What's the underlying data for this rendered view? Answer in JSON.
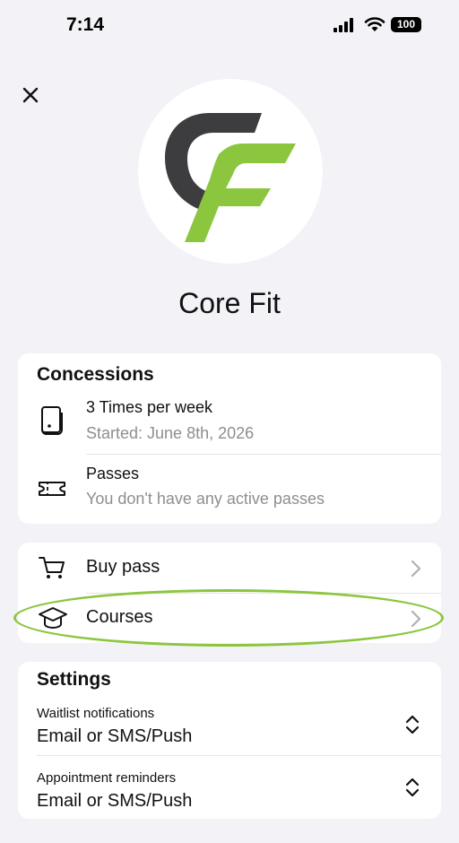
{
  "status_bar": {
    "time": "7:14",
    "battery": "100"
  },
  "profile": {
    "name": "Core Fit"
  },
  "concessions": {
    "title": "Concessions",
    "items": [
      {
        "title": "3 Times per week",
        "subtitle": "Started: June 8th, 2026",
        "icon": "membership-card-icon"
      },
      {
        "title": "Passes",
        "subtitle": "You don't have any active passes",
        "icon": "ticket-icon"
      }
    ]
  },
  "actions": {
    "items": [
      {
        "label": "Buy pass",
        "icon": "shopping-cart-icon"
      },
      {
        "label": "Courses",
        "icon": "graduation-cap-icon"
      }
    ]
  },
  "settings": {
    "title": "Settings",
    "items": [
      {
        "label": "Waitlist notifications",
        "value": "Email or SMS/Push"
      },
      {
        "label": "Appointment reminders",
        "value": "Email or SMS/Push"
      }
    ]
  },
  "colors": {
    "brand_green": "#8cc63f",
    "brand_dark": "#3d3d3f",
    "background": "#f2f2f7"
  }
}
